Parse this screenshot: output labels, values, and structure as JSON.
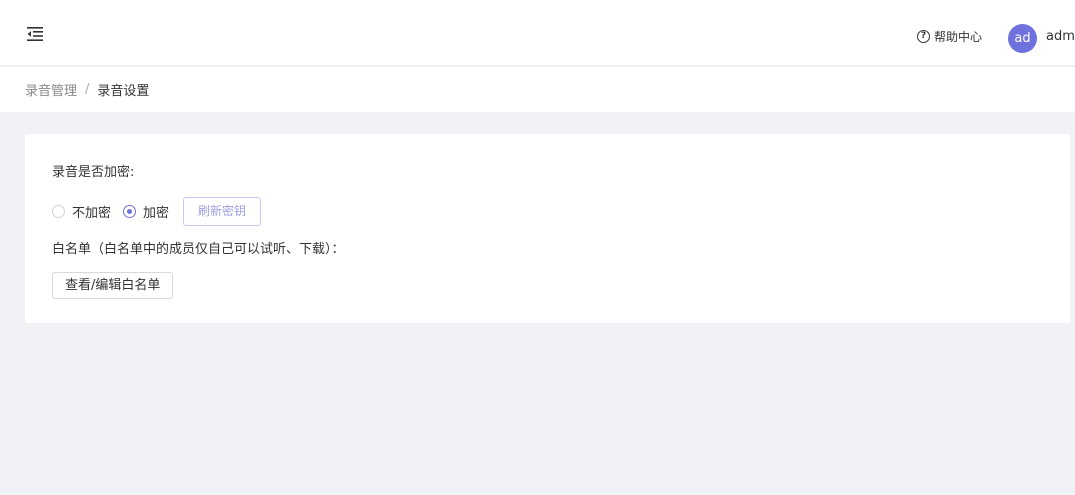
{
  "header": {
    "menu_icon": "menu-fold-icon",
    "help_icon": "question-circle-icon",
    "help_label": "帮助中心",
    "avatar_text": "ad",
    "username": "admin"
  },
  "breadcrumb": {
    "parent": "录音管理",
    "separator": "/",
    "current": "录音设置"
  },
  "settings": {
    "encrypt_label": "录音是否加密:",
    "options": [
      {
        "label": "不加密",
        "checked": false
      },
      {
        "label": "加密",
        "checked": true
      }
    ],
    "refresh_key_label": "刷新密钥",
    "whitelist_label": "白名单（白名单中的成员仅自己可以试听、下载）：",
    "whitelist_button": "查看/编辑白名单"
  },
  "colors": {
    "accent": "#6f72de",
    "page_bg": "#f0f2f5"
  }
}
